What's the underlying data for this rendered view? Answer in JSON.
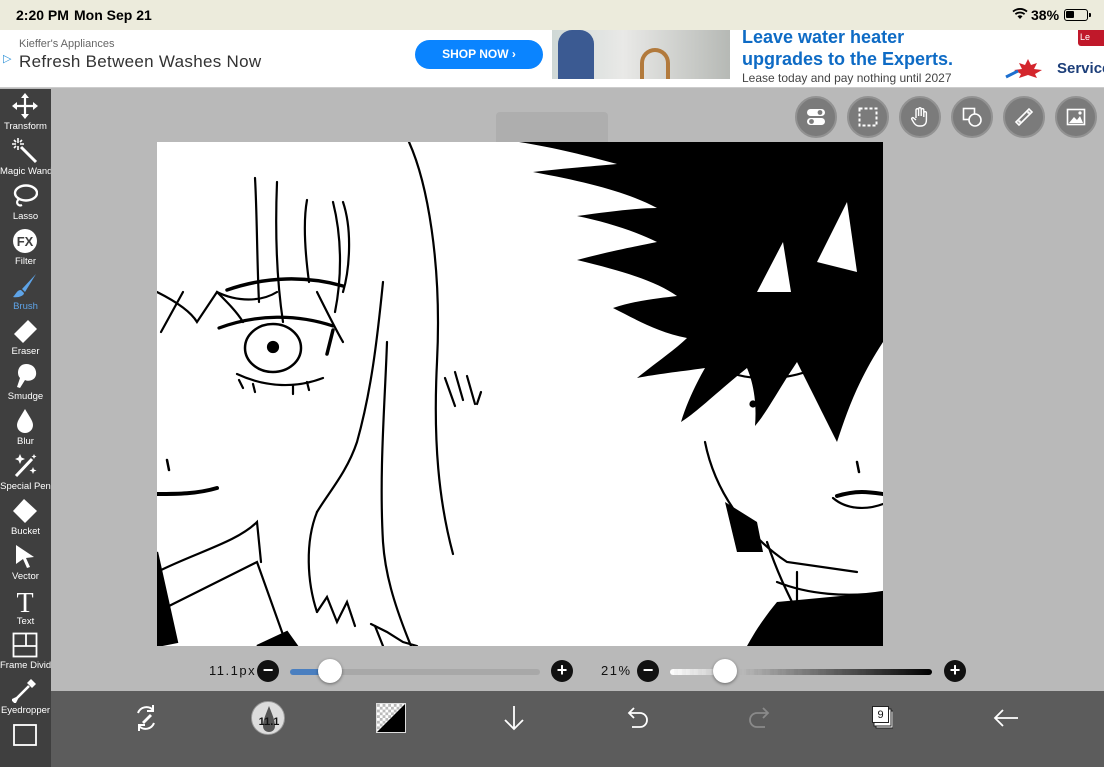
{
  "status_bar": {
    "time": "2:20 PM",
    "date": "Mon Sep 21",
    "battery": "38%"
  },
  "ad": {
    "advertiser": "Kieffer's Appliances",
    "headline": "Refresh Between Washes Now",
    "cta": "SHOP NOW ›",
    "headline2_line1": "Leave water heater",
    "headline2_line2": "upgrades to the Experts.",
    "sub": "Lease today and pay nothing until 2027",
    "brand": "Service",
    "tab": "Le"
  },
  "tools": [
    {
      "label": "Transform",
      "icon": "move-icon"
    },
    {
      "label": "Magic Wand",
      "icon": "magic-wand-icon"
    },
    {
      "label": "Lasso",
      "icon": "lasso-icon"
    },
    {
      "label": "Filter",
      "icon": "fx-icon"
    },
    {
      "label": "Brush",
      "icon": "brush-icon",
      "active": true
    },
    {
      "label": "Eraser",
      "icon": "eraser-icon"
    },
    {
      "label": "Smudge",
      "icon": "smudge-icon"
    },
    {
      "label": "Blur",
      "icon": "blur-drop-icon"
    },
    {
      "label": "Special Pen",
      "icon": "sparkle-pen-icon"
    },
    {
      "label": "Bucket",
      "icon": "bucket-icon"
    },
    {
      "label": "Vector",
      "icon": "cursor-icon"
    },
    {
      "label": "Text",
      "icon": "text-icon"
    },
    {
      "label": "Frame Divider",
      "icon": "frame-divider-icon"
    },
    {
      "label": "Eyedropper",
      "icon": "eyedropper-icon"
    }
  ],
  "top_buttons": [
    "toggle-icon",
    "selection-icon",
    "hand-icon",
    "shapes-icon",
    "ruler-icon",
    "image-icon"
  ],
  "brush_size": {
    "value": "11.1px",
    "fraction": 0.16
  },
  "opacity": {
    "value": "21%",
    "fraction": 0.21
  },
  "bottom_bar": {
    "brush_size_text": "11.1",
    "layer_count": "9",
    "icons": [
      "swap-tools-icon",
      "brush-preview-icon",
      "color-swatch-icon",
      "download-icon",
      "undo-icon",
      "redo-icon",
      "layers-icon",
      "back-icon"
    ]
  },
  "colors": {
    "panel": "#3f3f3f",
    "accent": "#5ea4e8",
    "bottom": "#5c5c5c",
    "workspace": "#b9b9b9"
  }
}
